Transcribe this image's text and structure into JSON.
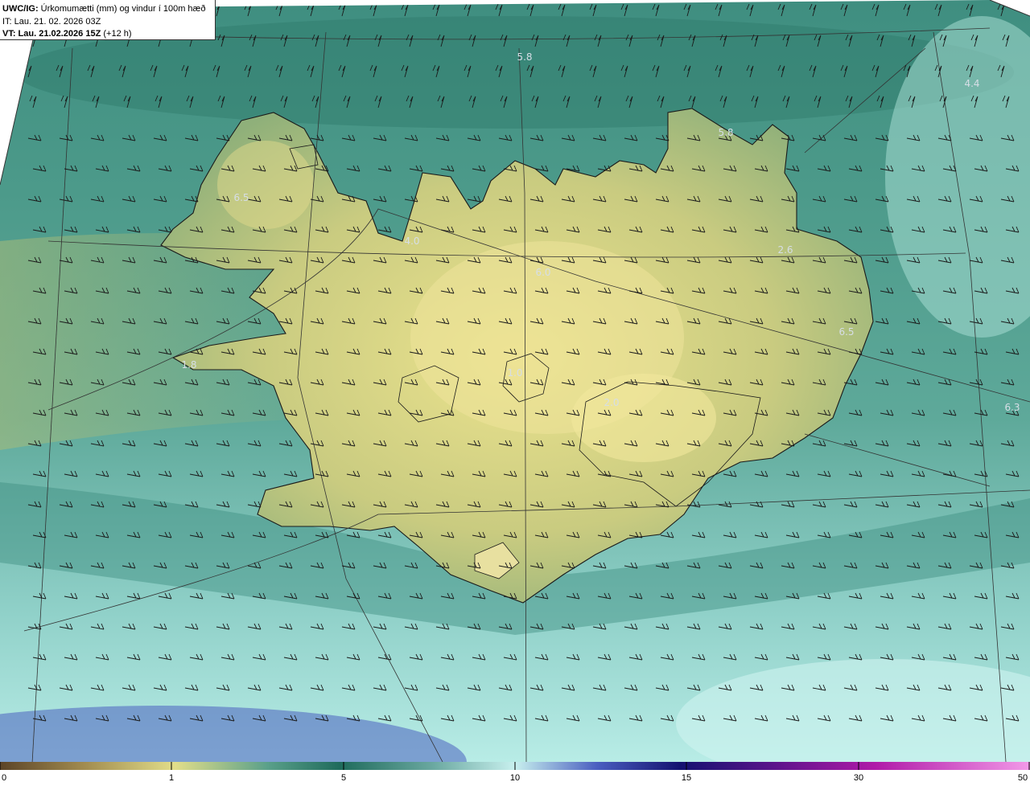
{
  "header": {
    "model": "UWC/IG:",
    "product": "Úrkomumætti (mm) og vindur í 100m hæð",
    "init_time": "IT: Lau. 21. 02. 2026 03Z",
    "valid_prefix": "VT: Lau. 21.02.2026 15Z",
    "valid_offset": "(+12 h)"
  },
  "map_labels": [
    "5.8",
    "4.4",
    "5.8",
    "4.0",
    "2.6",
    "6.5",
    "1.0",
    "6.3",
    "1.8",
    "6.0",
    "2.0",
    "6.5"
  ],
  "colorbar": {
    "ticks": [
      "0",
      "1",
      "5",
      "10",
      "15",
      "30",
      "50"
    ],
    "colors": [
      "#5c4428",
      "#a08a4e",
      "#e2de8a",
      "#5aa08a",
      "#1f6b5c",
      "#6aa8a0",
      "#c8f0ee",
      "#4a5ec0",
      "#141270",
      "#5a148a",
      "#b01aa8",
      "#f29ae8"
    ]
  },
  "map_colors": {
    "sea": "#5aa89a",
    "sea_deep": "#2c7a6a",
    "sea_light": "#9ddad2",
    "land": "#c6c980",
    "land_high": "#e6df8e",
    "coast": "#1a1a1a",
    "grid": "#333333"
  }
}
